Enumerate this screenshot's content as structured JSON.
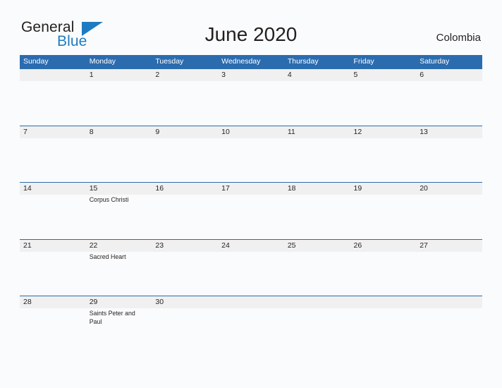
{
  "brand": {
    "name_part1": "General",
    "name_part2": "Blue",
    "flag_icon": "blue-triangle-flag",
    "color_dark": "#231f20",
    "color_blue": "#1f7bc1"
  },
  "header": {
    "title": "June 2020",
    "country": "Colombia"
  },
  "calendar": {
    "month": "June",
    "year": "2020",
    "header_color": "#2b6caf",
    "row_band_color": "#f0f0f0",
    "weekday_headers": [
      "Sunday",
      "Monday",
      "Tuesday",
      "Wednesday",
      "Thursday",
      "Friday",
      "Saturday"
    ],
    "weeks": [
      {
        "days": [
          {
            "num": "",
            "event": ""
          },
          {
            "num": "1",
            "event": ""
          },
          {
            "num": "2",
            "event": ""
          },
          {
            "num": "3",
            "event": ""
          },
          {
            "num": "4",
            "event": ""
          },
          {
            "num": "5",
            "event": ""
          },
          {
            "num": "6",
            "event": ""
          }
        ]
      },
      {
        "days": [
          {
            "num": "7",
            "event": ""
          },
          {
            "num": "8",
            "event": ""
          },
          {
            "num": "9",
            "event": ""
          },
          {
            "num": "10",
            "event": ""
          },
          {
            "num": "11",
            "event": ""
          },
          {
            "num": "12",
            "event": ""
          },
          {
            "num": "13",
            "event": ""
          }
        ]
      },
      {
        "days": [
          {
            "num": "14",
            "event": ""
          },
          {
            "num": "15",
            "event": "Corpus Christi"
          },
          {
            "num": "16",
            "event": ""
          },
          {
            "num": "17",
            "event": ""
          },
          {
            "num": "18",
            "event": ""
          },
          {
            "num": "19",
            "event": ""
          },
          {
            "num": "20",
            "event": ""
          }
        ]
      },
      {
        "days": [
          {
            "num": "21",
            "event": ""
          },
          {
            "num": "22",
            "event": "Sacred Heart"
          },
          {
            "num": "23",
            "event": ""
          },
          {
            "num": "24",
            "event": ""
          },
          {
            "num": "25",
            "event": ""
          },
          {
            "num": "26",
            "event": ""
          },
          {
            "num": "27",
            "event": ""
          }
        ]
      },
      {
        "days": [
          {
            "num": "28",
            "event": ""
          },
          {
            "num": "29",
            "event": "Saints Peter and Paul"
          },
          {
            "num": "30",
            "event": ""
          },
          {
            "num": "",
            "event": ""
          },
          {
            "num": "",
            "event": ""
          },
          {
            "num": "",
            "event": ""
          },
          {
            "num": "",
            "event": ""
          }
        ]
      }
    ]
  }
}
